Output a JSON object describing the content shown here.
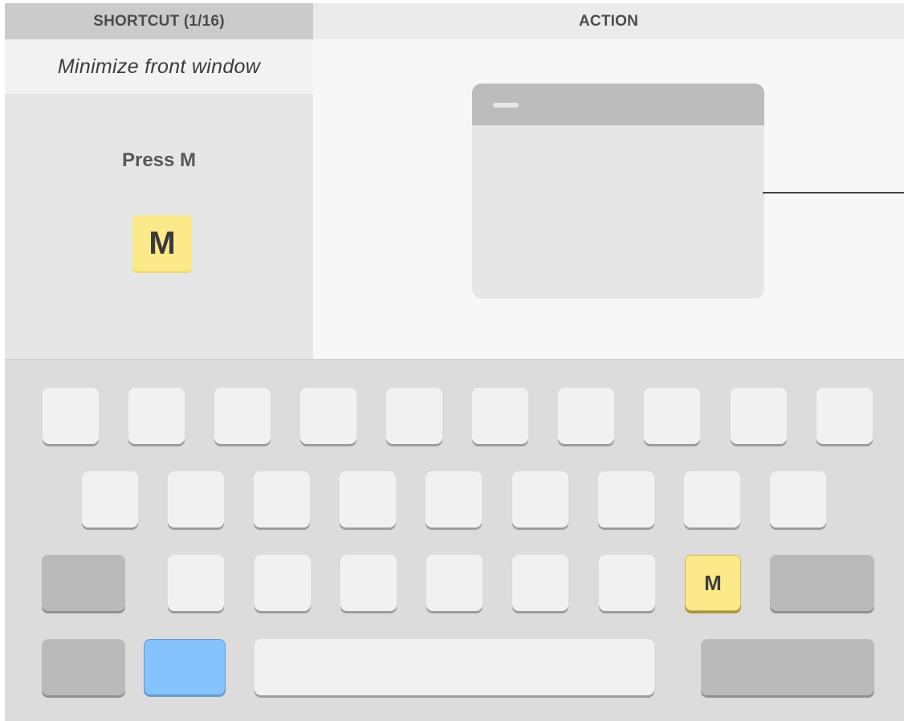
{
  "header": {
    "shortcut_label": "SHORTCUT (1/16)",
    "action_label": "ACTION"
  },
  "shortcut": {
    "title": "Minimize front window",
    "instruction": "Press M",
    "key": "M"
  },
  "keyboard": {
    "highlighted_key": "M",
    "highlight_color": "#fbe98a",
    "command_key_color": "#86c2fb"
  },
  "colors": {
    "header_left_bg": "#cbcbcb",
    "header_right_bg": "#ebebeb",
    "keyboard_bg": "#dcdcdc"
  }
}
